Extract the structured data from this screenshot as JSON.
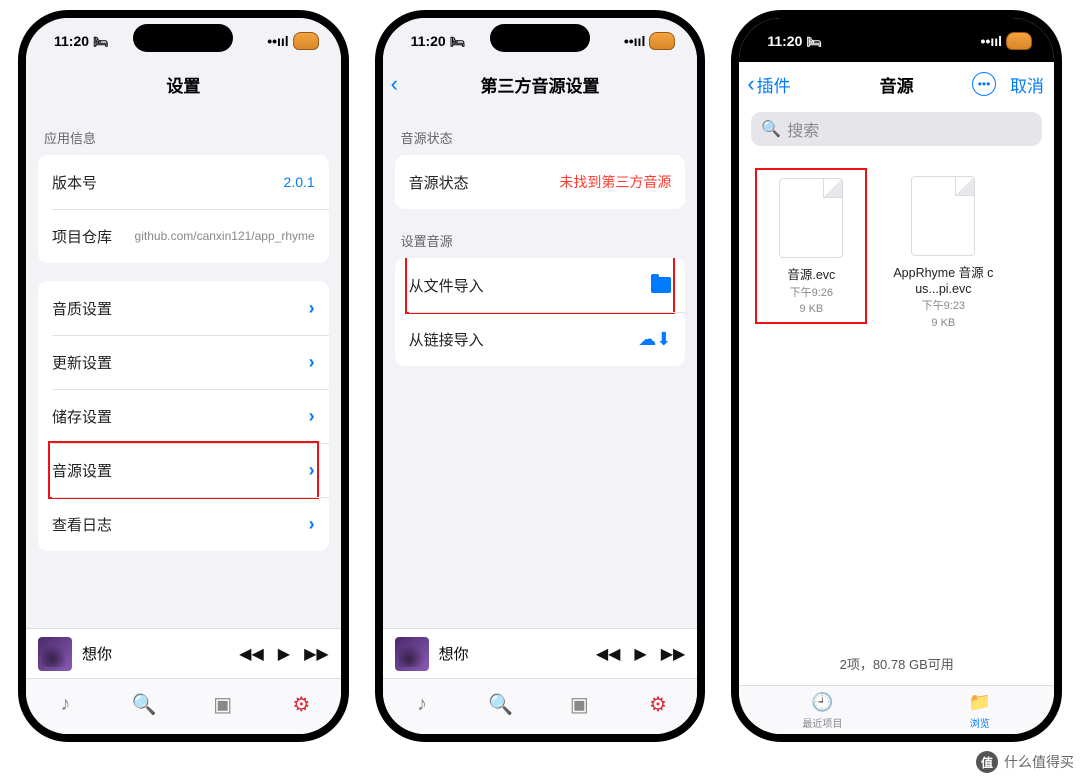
{
  "status": {
    "time": "11:20"
  },
  "phone1": {
    "title": "设置",
    "sections": {
      "appInfo": {
        "header": "应用信息",
        "version_label": "版本号",
        "version_value": "2.0.1",
        "repo_label": "项目仓库",
        "repo_value": "github.com/canxin121/app_rhyme"
      },
      "settings": {
        "quality": "音质设置",
        "update": "更新设置",
        "storage": "储存设置",
        "source": "音源设置",
        "log": "查看日志"
      }
    },
    "player": {
      "song": "想你"
    }
  },
  "phone2": {
    "back": "",
    "title": "第三方音源设置",
    "status_header": "音源状态",
    "status_label": "音源状态",
    "status_value": "未找到第三方音源",
    "set_header": "设置音源",
    "import_file": "从文件导入",
    "import_link": "从链接导入",
    "player": {
      "song": "想你"
    }
  },
  "phone3": {
    "back": "插件",
    "title": "音源",
    "cancel": "取消",
    "search_placeholder": "搜索",
    "files": [
      {
        "name": "音源.evc",
        "time": "下午9:26",
        "size": "9 KB",
        "highlight": true
      },
      {
        "name": "AppRhyme 音源 cus...pi.evc",
        "time": "下午9:23",
        "size": "9 KB",
        "highlight": false
      }
    ],
    "footer_status": "2项，80.78 GB可用",
    "tab_recent": "最近项目",
    "tab_browse": "浏览"
  },
  "watermark": "什么值得买"
}
